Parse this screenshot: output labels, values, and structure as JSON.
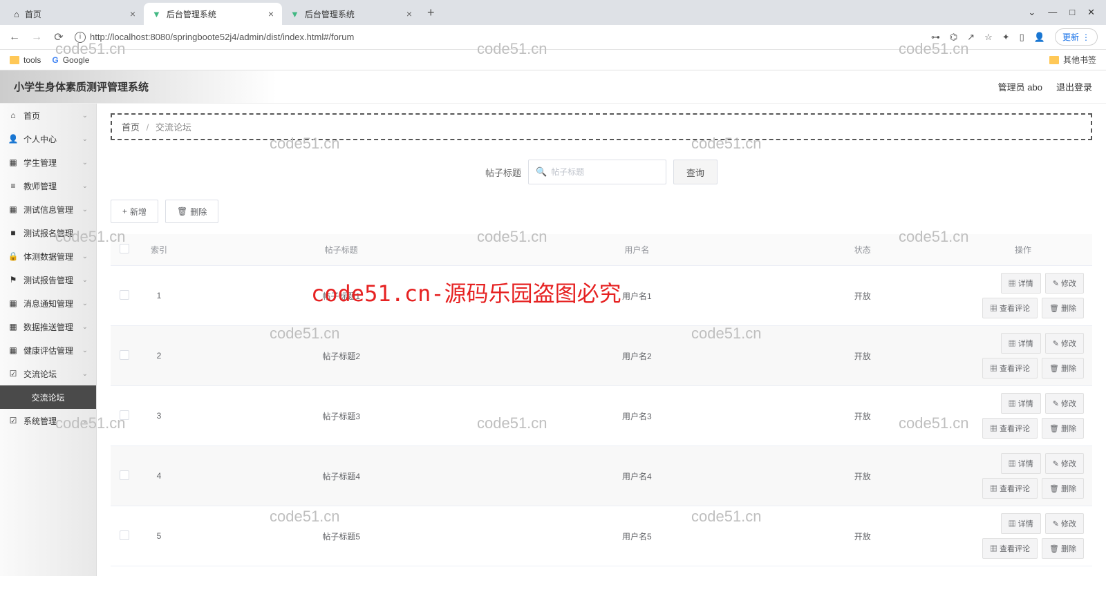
{
  "browser": {
    "tabs": [
      {
        "title": "首页",
        "icon": "home"
      },
      {
        "title": "后台管理系统",
        "icon": "vue",
        "active": true
      },
      {
        "title": "后台管理系统",
        "icon": "vue"
      }
    ],
    "url": "http://localhost:8080/springboote52j4/admin/dist/index.html#/forum",
    "update_label": "更新",
    "bookmarks": {
      "tools": "tools",
      "google": "Google",
      "other": "其他书签"
    }
  },
  "app": {
    "title": "小学生身体素质测评管理系统",
    "user_label": "管理员 abo",
    "logout": "退出登录"
  },
  "sidebar": {
    "items": [
      {
        "label": "首页",
        "icon": "⌂"
      },
      {
        "label": "个人中心",
        "icon": "👤"
      },
      {
        "label": "学生管理",
        "icon": "▦"
      },
      {
        "label": "教师管理",
        "icon": "≡"
      },
      {
        "label": "测试信息管理",
        "icon": "▦"
      },
      {
        "label": "测试报名管理",
        "icon": "■"
      },
      {
        "label": "体测数据管理",
        "icon": "🔒"
      },
      {
        "label": "测试报告管理",
        "icon": "⚑"
      },
      {
        "label": "消息通知管理",
        "icon": "▦"
      },
      {
        "label": "数据推送管理",
        "icon": "▦"
      },
      {
        "label": "健康评估管理",
        "icon": "▦"
      },
      {
        "label": "交流论坛",
        "icon": "☑"
      },
      {
        "label": "系统管理",
        "icon": "☑"
      }
    ],
    "active_sub": "交流论坛"
  },
  "breadcrumb": {
    "home": "首页",
    "current": "交流论坛"
  },
  "search": {
    "label": "帖子标题",
    "placeholder": "帖子标题",
    "query_btn": "查询"
  },
  "actions": {
    "add": "新增",
    "delete": "删除"
  },
  "table": {
    "headers": {
      "index": "索引",
      "title": "帖子标题",
      "user": "用户名",
      "status": "状态",
      "ops": "操作"
    },
    "ops": {
      "detail": "详情",
      "edit": "修改",
      "comments": "查看评论",
      "delete": "删除"
    },
    "rows": [
      {
        "idx": "1",
        "title": "帖子标题1",
        "user": "用户名1",
        "status": "开放"
      },
      {
        "idx": "2",
        "title": "帖子标题2",
        "user": "用户名2",
        "status": "开放"
      },
      {
        "idx": "3",
        "title": "帖子标题3",
        "user": "用户名3",
        "status": "开放"
      },
      {
        "idx": "4",
        "title": "帖子标题4",
        "user": "用户名4",
        "status": "开放"
      },
      {
        "idx": "5",
        "title": "帖子标题5",
        "user": "用户名5",
        "status": "开放"
      }
    ]
  },
  "watermarks": {
    "small": "code51.cn",
    "big": "code51.cn-源码乐园盗图必究"
  }
}
